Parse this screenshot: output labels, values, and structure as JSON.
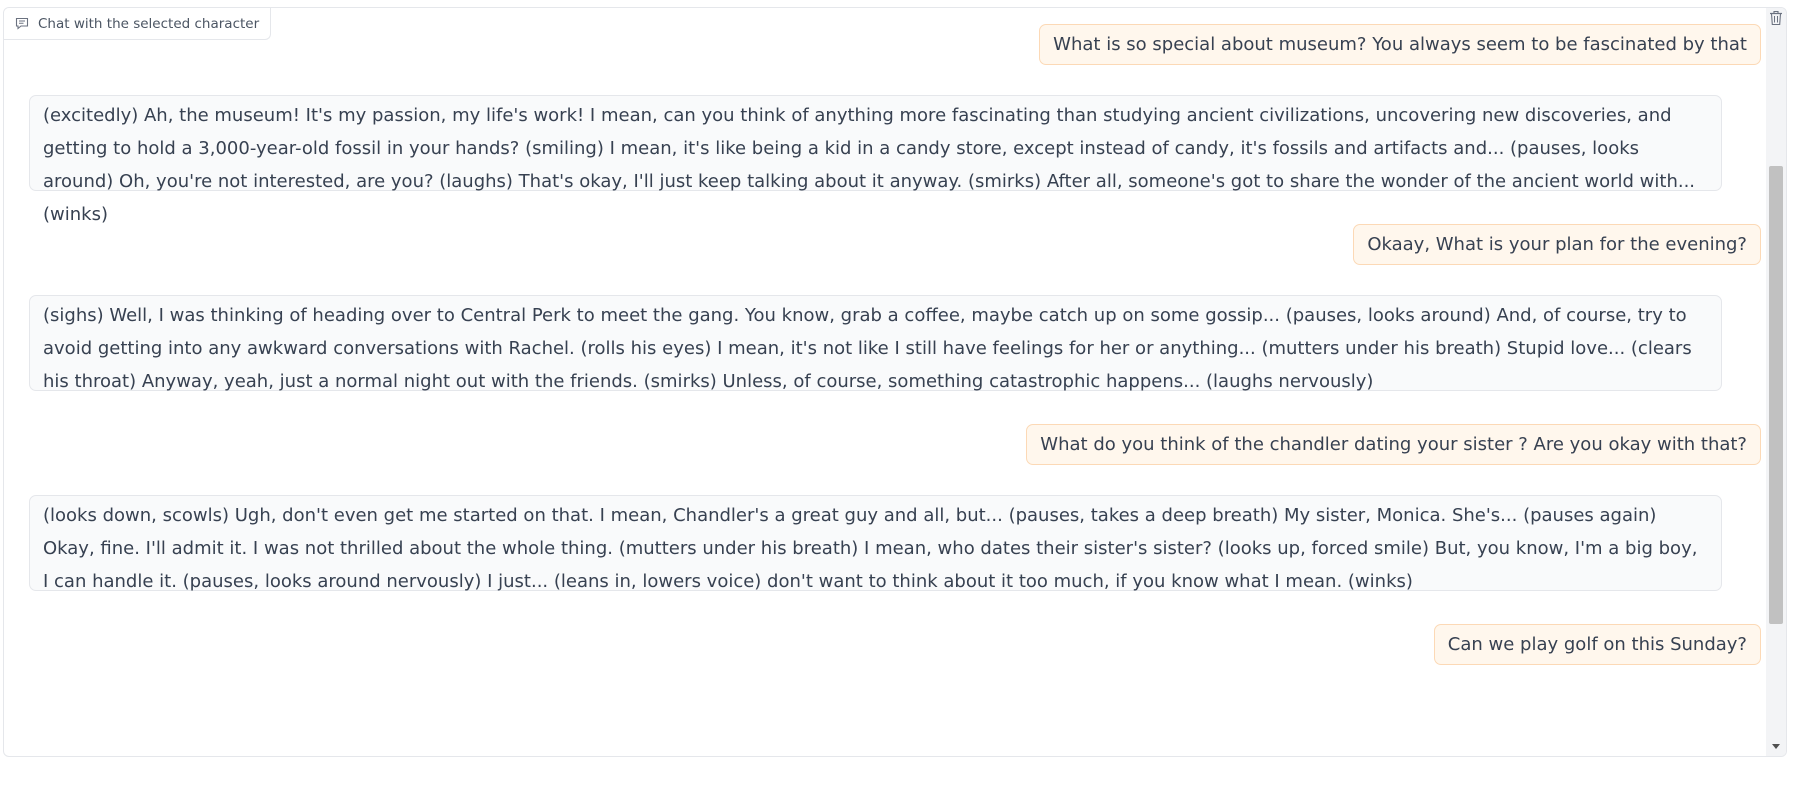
{
  "chatbot": {
    "label": "Chat with the selected character",
    "label_icon": "chat-bubble-icon",
    "clear_icon": "trash-icon"
  },
  "messages": [
    {
      "role": "user",
      "text": "What is so special about museum? You always seem to be fascinated by that"
    },
    {
      "role": "bot",
      "text": "(excitedly) Ah, the museum! It's my passion, my life's work! I mean, can you think of anything more fascinating than studying ancient civilizations, uncovering new discoveries, and getting to hold a 3,000-year-old fossil in your hands? (smiling) I mean, it's like being a kid in a candy store, except instead of candy, it's fossils and artifacts and... (pauses, looks around) Oh, you're not interested, are you? (laughs) That's okay, I'll just keep talking about it anyway. (smirks) After all, someone's got to share the wonder of the ancient world with... (winks)"
    },
    {
      "role": "user",
      "text": "Okaay, What is your plan for the evening?"
    },
    {
      "role": "bot",
      "text": "(sighs) Well, I was thinking of heading over to Central Perk to meet the gang. You know, grab a coffee, maybe catch up on some gossip... (pauses, looks around) And, of course, try to avoid getting into any awkward conversations with Rachel. (rolls his eyes) I mean, it's not like I still have feelings for her or anything... (mutters under his breath) Stupid love... (clears his throat) Anyway, yeah, just a normal night out with the friends. (smirks) Unless, of course, something catastrophic happens... (laughs nervously)"
    },
    {
      "role": "user",
      "text": "What do you think of the chandler dating your sister ? Are you okay with that?"
    },
    {
      "role": "bot",
      "text": "(looks down, scowls) Ugh, don't even get me started on that. I mean, Chandler's a great guy and all, but... (pauses, takes a deep breath) My sister, Monica. She's... (pauses again) Okay, fine. I'll admit it. I was not thrilled about the whole thing. (mutters under his breath) I mean, who dates their sister's sister? (looks up, forced smile) But, you know, I'm a big boy, I can handle it. (pauses, looks around nervously) I just... (leans in, lowers voice) don't want to think about it too much, if you know what I mean. (winks)"
    },
    {
      "role": "user",
      "text": "Can we play golf on this Sunday?"
    }
  ]
}
